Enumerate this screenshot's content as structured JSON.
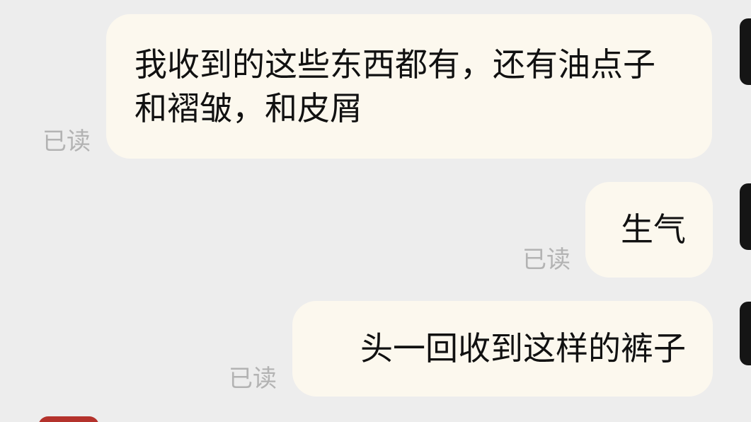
{
  "messages": [
    {
      "text": "我收到的这些东西都有，还有油点子和褶皱，和皮屑",
      "status": "已读"
    },
    {
      "text": "生气",
      "status": "已读"
    },
    {
      "text": "头一回收到这样的裤子",
      "status": "已读"
    }
  ],
  "colors": {
    "background": "#ededed",
    "bubble": "#fcf8ee",
    "read_status": "#b3b3b3",
    "badge": "#b4322c"
  }
}
